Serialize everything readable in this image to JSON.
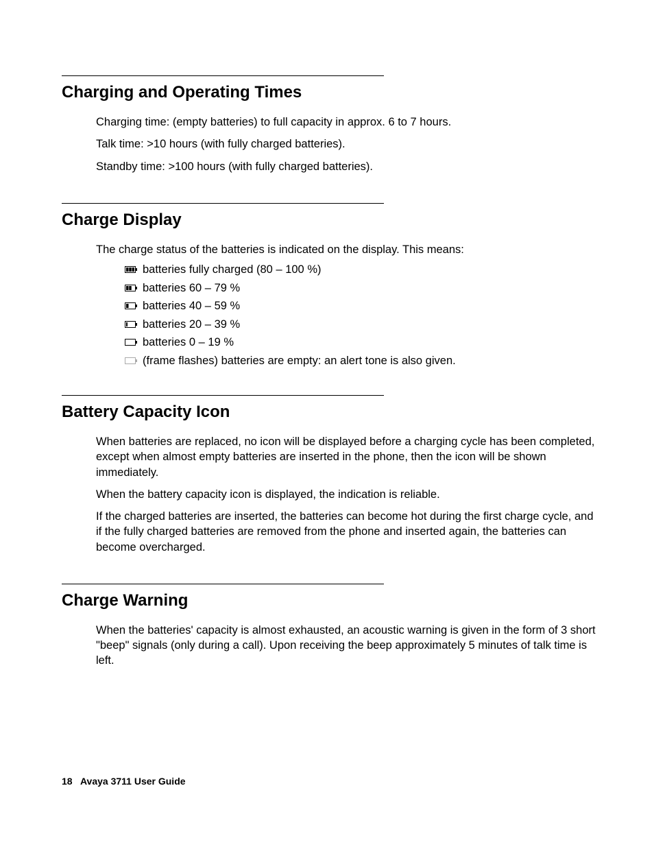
{
  "sections": {
    "charging_times": {
      "heading": "Charging and Operating Times",
      "p1": "Charging time: (empty batteries) to full capacity in approx. 6 to 7 hours.",
      "p2": "Talk time: >10 hours (with fully charged batteries).",
      "p3": "Standby time: >100 hours (with fully charged batteries)."
    },
    "charge_display": {
      "heading": "Charge Display",
      "intro": "The charge status of the batteries is indicated on the display. This means:",
      "items": [
        {
          "icon": "battery-full-icon",
          "label": "batteries fully charged (80 – 100 %)"
        },
        {
          "icon": "battery-60-icon",
          "label": "batteries 60 – 79 %"
        },
        {
          "icon": "battery-40-icon",
          "label": "batteries 40 – 59 %"
        },
        {
          "icon": "battery-20-icon",
          "label": "batteries 20 – 39 %"
        },
        {
          "icon": "battery-0-icon",
          "label": "batteries 0 – 19 %"
        },
        {
          "icon": "battery-empty-icon",
          "label": "(frame flashes) batteries are empty: an alert tone is also given."
        }
      ]
    },
    "battery_capacity": {
      "heading": "Battery Capacity Icon",
      "p1": "When batteries are replaced, no icon will be displayed before a charging cycle has been completed, except when almost empty batteries are inserted in the phone, then the icon will be shown immediately.",
      "p2": "When the battery capacity icon is displayed, the indication is reliable.",
      "p3": "If the charged batteries are inserted, the batteries can become hot during the first charge cycle, and if the fully charged batteries are removed from the phone and inserted again, the batteries can become overcharged."
    },
    "charge_warning": {
      "heading": "Charge Warning",
      "p1": "When the batteries' capacity is almost exhausted, an acoustic warning is given in the form of 3 short \"beep\" signals (only during a call). Upon receiving the beep approximately 5 minutes of talk time is left."
    }
  },
  "footer": {
    "page_number": "18",
    "doc_title": "Avaya 3711 User Guide"
  }
}
